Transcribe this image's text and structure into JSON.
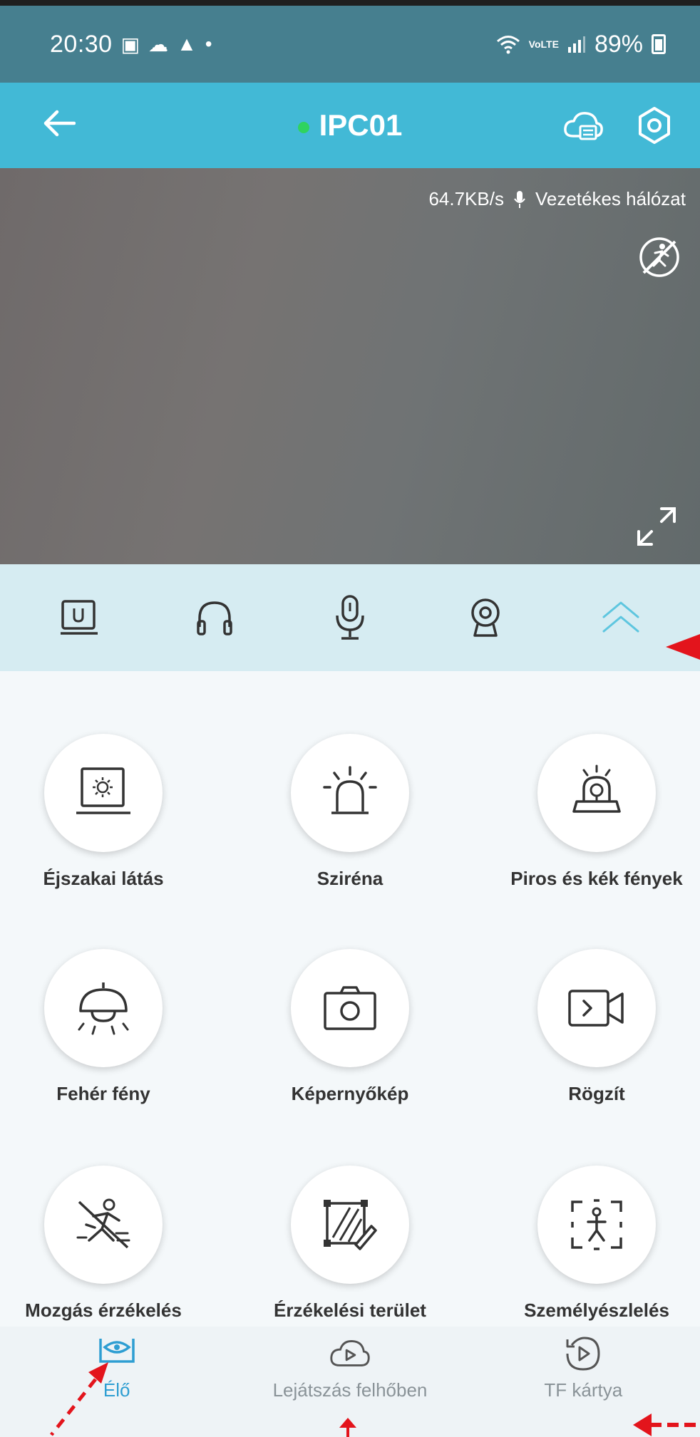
{
  "status_bar": {
    "time": "20:30",
    "battery": "89%",
    "network_tag": "VoLTE"
  },
  "header": {
    "title": "IPC01",
    "online": true
  },
  "video": {
    "speed": "64.7KB/s",
    "network": "Vezetékes hálózat"
  },
  "controls": [
    {
      "name": "night-vision-toggle",
      "icon": "monitor-u-icon"
    },
    {
      "name": "audio-listen",
      "icon": "headphones-icon"
    },
    {
      "name": "talk",
      "icon": "microphone-icon"
    },
    {
      "name": "camera-ptz",
      "icon": "webcam-icon"
    },
    {
      "name": "collapse-panel",
      "icon": "double-chevron-up-icon"
    }
  ],
  "features": [
    {
      "label": "Éjszakai látás",
      "icon": "night-vision-icon"
    },
    {
      "label": "Sziréna",
      "icon": "siren-icon"
    },
    {
      "label": "Piros és kék fények",
      "icon": "police-light-icon"
    },
    {
      "label": "Fehér fény",
      "icon": "ceiling-lamp-icon"
    },
    {
      "label": "Képernyőkép",
      "icon": "camera-icon"
    },
    {
      "label": "Rögzít",
      "icon": "video-record-icon"
    },
    {
      "label": "Mozgás érzékelés",
      "icon": "motion-detection-icon"
    },
    {
      "label": "Érzékelési terület rajzolása",
      "icon": "draw-area-icon"
    },
    {
      "label": "Személyészlelés nyomon",
      "icon": "person-tracking-icon"
    }
  ],
  "bottom_nav": [
    {
      "label": "Élő",
      "active": true
    },
    {
      "label": "Lejátszás felhőben",
      "active": false
    },
    {
      "label": "TF kártya",
      "active": false
    }
  ],
  "colors": {
    "status_bar": "#467f8f",
    "header": "#42b9d6",
    "control_bar": "#d6ecf2",
    "accent": "#2e9ed2",
    "annotation": "#e3141c"
  }
}
